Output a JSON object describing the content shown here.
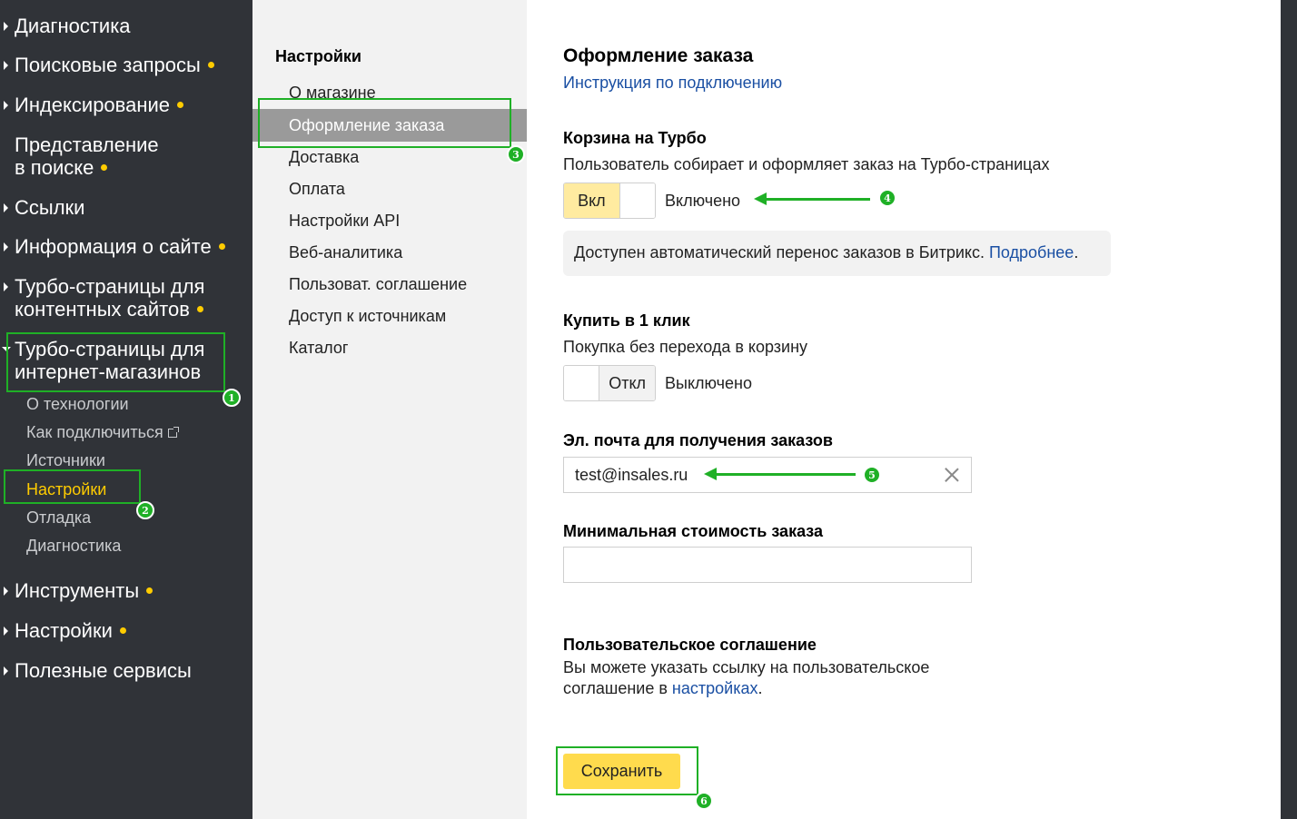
{
  "sidebar": {
    "items": [
      {
        "label": "Диагностика"
      },
      {
        "label": "Поисковые запросы"
      },
      {
        "label": "Индексирование"
      },
      {
        "label_line1": "Представление",
        "label_line2": "в поиске"
      },
      {
        "label": "Ссылки"
      },
      {
        "label": "Информация о сайте"
      },
      {
        "label_line1": "Турбо-страницы для",
        "label_line2": "контентных сайтов"
      },
      {
        "label_line1": "Турбо-страницы для",
        "label_line2": "интернет-магазинов"
      },
      {
        "label": "Инструменты"
      },
      {
        "label": "Настройки"
      },
      {
        "label": "Полезные сервисы"
      }
    ],
    "subitems": [
      {
        "label": "О технологии"
      },
      {
        "label": "Как подключиться"
      },
      {
        "label": "Источники"
      },
      {
        "label": "Настройки"
      },
      {
        "label": "Отладка"
      },
      {
        "label": "Диагностика"
      }
    ]
  },
  "settings_nav": {
    "title": "Настройки",
    "items": [
      {
        "label": "О магазине"
      },
      {
        "label": "Оформление заказа"
      },
      {
        "label": "Доставка"
      },
      {
        "label": "Оплата"
      },
      {
        "label": "Настройки API"
      },
      {
        "label": "Веб-аналитика"
      },
      {
        "label": "Пользоват. соглашение"
      },
      {
        "label": "Доступ к источникам"
      },
      {
        "label": "Каталог"
      }
    ]
  },
  "main": {
    "title": "Оформление заказа",
    "instruction_link": "Инструкция по подключению",
    "cart": {
      "title": "Корзина на Турбо",
      "desc": "Пользователь собирает и оформляет заказ на Турбо-страницах",
      "toggle_label": "Вкл",
      "state": "Включено"
    },
    "notice": {
      "text": "Доступен автоматический перенос заказов в Битрикс. ",
      "link": "Подробнее",
      "end": "."
    },
    "one_click": {
      "title": "Купить в 1 клик",
      "desc": "Покупка без перехода в корзину",
      "toggle_label": "Откл",
      "state": "Выключено"
    },
    "email": {
      "title": "Эл. почта для получения заказов",
      "value": "test@insales.ru"
    },
    "min_cost": {
      "title": "Минимальная стоимость заказа",
      "value": ""
    },
    "agreement": {
      "title": "Пользовательское соглашение",
      "line1": "Вы можете указать ссылку на пользовательское",
      "line2_prefix": "соглашение в ",
      "line2_link": "настройках",
      "line2_end": "."
    },
    "save_label": "Сохранить"
  },
  "annotations": [
    "1",
    "2",
    "3",
    "4",
    "5",
    "6"
  ],
  "colors": {
    "accent": "#ffdb4d",
    "annotation": "#1fb026",
    "sidebar_bg": "#303338",
    "link": "#1a4fa3"
  }
}
